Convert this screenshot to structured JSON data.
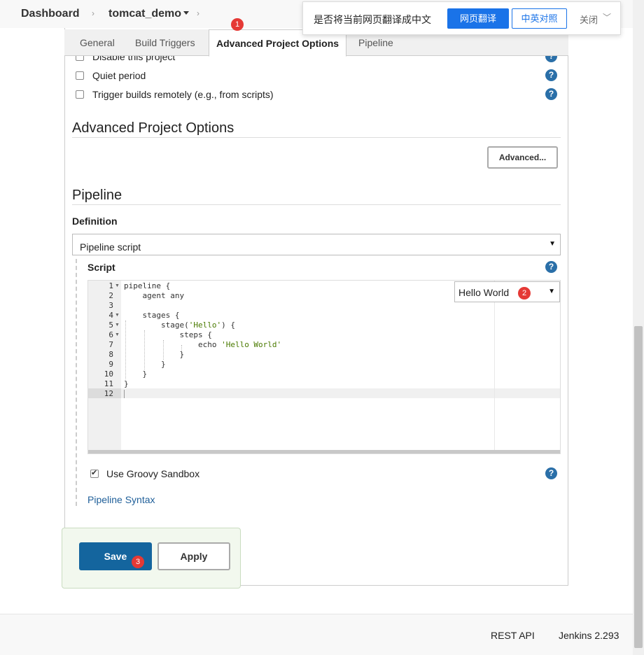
{
  "breadcrumb": {
    "dashboard": "Dashboard",
    "job": "tomcat_demo",
    "dropdown_icon": "caret-down-icon",
    "separator": "›"
  },
  "tabs": [
    "General",
    "Build Triggers",
    "Advanced Project Options",
    "Pipeline"
  ],
  "triggers": {
    "disable": "Disable this project",
    "quiet": "Quiet period",
    "remote": "Trigger builds remotely (e.g., from scripts)"
  },
  "help_glyph": "?",
  "advanced_section": {
    "title": "Advanced Project Options",
    "button": "Advanced..."
  },
  "pipeline": {
    "title": "Pipeline",
    "definition_label": "Definition",
    "definition_value": "Pipeline script",
    "script_label": "Script",
    "sample_value": "Hello World",
    "sandbox_label": "Use Groovy Sandbox",
    "sandbox_checked": true,
    "syntax_link": "Pipeline Syntax"
  },
  "editor": {
    "line_numbers": [
      "1",
      "2",
      "3",
      "4",
      "5",
      "6",
      "7",
      "8",
      "9",
      "10",
      "11",
      "12"
    ],
    "lines": [
      "pipeline {",
      "    agent any",
      "",
      "    stages {",
      "        stage(",
      "            steps {",
      "                echo ",
      "            }",
      "        }",
      "    }",
      "}",
      ""
    ],
    "stage_arg": "'Hello'",
    "stage_rest": ") {",
    "echo_arg": "'Hello World'"
  },
  "actions": {
    "save": "Save",
    "apply": "Apply"
  },
  "badges": [
    "1",
    "2",
    "3"
  ],
  "footer": {
    "rest_api": "REST API",
    "version": "Jenkins 2.293"
  },
  "translate_bar": {
    "prompt": "是否将当前网页翻译成中文",
    "translate": "网页翻译",
    "bilingual": "中英对照",
    "close": "关闭",
    "chevron": "﹀"
  },
  "colors": {
    "primary": "#14659e",
    "help": "#2a6fa8",
    "badge": "#e53935",
    "link": "#1f5f99",
    "translate_blue": "#1a73e8"
  }
}
